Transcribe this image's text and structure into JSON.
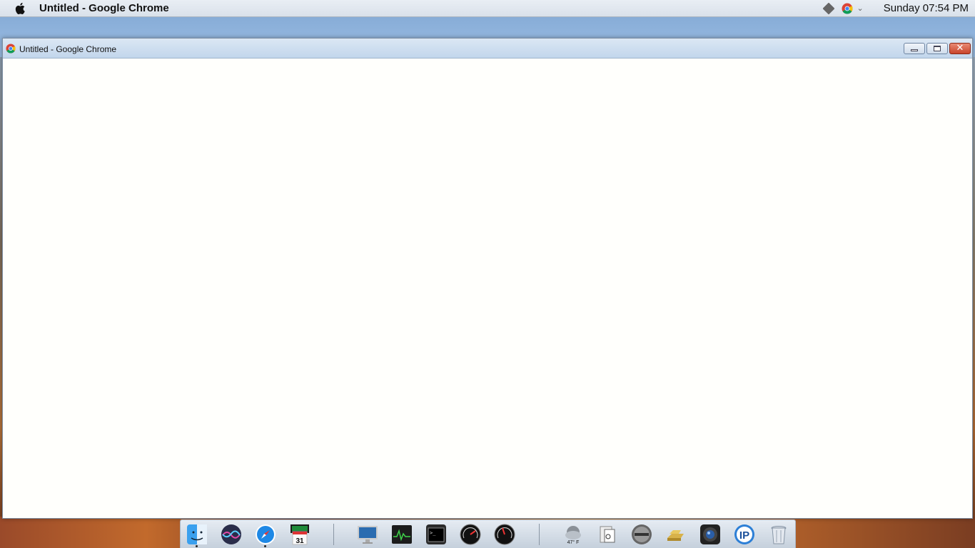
{
  "menubar": {
    "app_title": "Untitled - Google Chrome",
    "clock": "Sunday 07:54 PM",
    "icons": [
      "apple-icon",
      "diamond-tray-icon",
      "chrome-tray-icon",
      "chevron-down-icon"
    ]
  },
  "window": {
    "title": "Untitled - Google Chrome",
    "icon": "chrome-icon",
    "buttons": [
      "minimize",
      "maximize",
      "close"
    ]
  },
  "dock": {
    "calendar_day": "31",
    "weather_temp": "47° F",
    "items": [
      "finder",
      "siri",
      "safari",
      "calendar",
      "imac",
      "activity-monitor",
      "terminal",
      "speedometer",
      "gauge",
      "weather",
      "clipboard",
      "dvd-player",
      "gold-bars",
      "camera",
      "ip-scanner",
      "trash"
    ]
  }
}
